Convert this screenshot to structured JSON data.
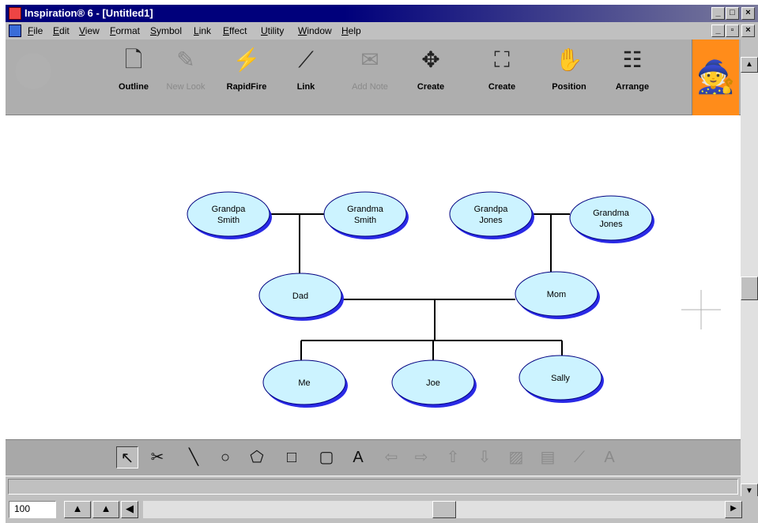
{
  "window": {
    "title": "Inspiration® 6 - [Untitled1]",
    "caption_buttons": [
      "_",
      "□",
      "×"
    ],
    "mdi_buttons": [
      "_",
      "▫",
      "×"
    ]
  },
  "menu": {
    "items": [
      "File",
      "Edit",
      "View",
      "Format",
      "Symbol",
      "Link",
      "Effect",
      "Utility",
      "Window",
      "Help"
    ]
  },
  "toolbar": {
    "tools": [
      {
        "label": "Outline",
        "icon": "outline-icon",
        "glyph": "🗋",
        "enabled": true
      },
      {
        "label": "New Look",
        "icon": "new-look-icon",
        "glyph": "✎",
        "enabled": false
      },
      {
        "label": "RapidFire",
        "icon": "rapidfire-icon",
        "glyph": "⚡",
        "enabled": true
      },
      {
        "label": "Link",
        "icon": "link-icon",
        "glyph": "⟋",
        "enabled": true
      },
      {
        "label": "Add Note",
        "icon": "add-note-icon",
        "glyph": "✉",
        "enabled": false
      },
      {
        "label": "Create",
        "icon": "create-arrows-icon",
        "glyph": "✥",
        "enabled": true
      },
      {
        "label": "Create",
        "icon": "create-expand-icon",
        "glyph": "⛶",
        "enabled": true
      },
      {
        "label": "Position",
        "icon": "hand-icon",
        "glyph": "✋",
        "enabled": true
      },
      {
        "label": "Arrange",
        "icon": "arrange-icon",
        "glyph": "☷",
        "enabled": true
      }
    ],
    "mascot_icon": "wizard-mascot-icon"
  },
  "diagram": {
    "colors": {
      "node_fill": "#ccf3ff",
      "node_shadow": "#2a2ae6",
      "node_stroke": "#000080",
      "link": "#000000"
    },
    "nodes": [
      {
        "id": "grandpa-smith",
        "lines": [
          "Grandpa",
          "Smith"
        ]
      },
      {
        "id": "grandma-smith",
        "lines": [
          "Grandma",
          "Smith"
        ]
      },
      {
        "id": "grandpa-jones",
        "lines": [
          "Grandpa",
          "Jones"
        ]
      },
      {
        "id": "grandma-jones",
        "lines": [
          "Grandma",
          "Jones"
        ]
      },
      {
        "id": "dad",
        "lines": [
          "Dad"
        ]
      },
      {
        "id": "mom",
        "lines": [
          "Mom"
        ]
      },
      {
        "id": "me",
        "lines": [
          "Me"
        ]
      },
      {
        "id": "joe",
        "lines": [
          "Joe"
        ]
      },
      {
        "id": "sally",
        "lines": [
          "Sally"
        ]
      }
    ]
  },
  "drawing_tools": [
    {
      "name": "pointer-tool",
      "glyph": "↖",
      "enabled": true,
      "active": true
    },
    {
      "name": "eraser-tool",
      "glyph": "✂",
      "enabled": true
    },
    {
      "name": "line-tool",
      "glyph": "╲",
      "enabled": true
    },
    {
      "name": "oval-tool",
      "glyph": "○",
      "enabled": true
    },
    {
      "name": "polygon-tool",
      "glyph": "⬠",
      "enabled": true
    },
    {
      "name": "rectangle-tool",
      "glyph": "□",
      "enabled": true
    },
    {
      "name": "rounded-rect-tool",
      "glyph": "▢",
      "enabled": true
    },
    {
      "name": "text-tool",
      "glyph": "A",
      "enabled": true
    },
    {
      "name": "arrow-left-tool",
      "glyph": "⇦",
      "enabled": false
    },
    {
      "name": "arrow-right-tool",
      "glyph": "⇨",
      "enabled": false
    },
    {
      "name": "arrow-up-tool",
      "glyph": "⇧",
      "enabled": false
    },
    {
      "name": "arrow-down-tool",
      "glyph": "⇩",
      "enabled": false
    },
    {
      "name": "fill-tool",
      "glyph": "▨",
      "enabled": false
    },
    {
      "name": "note-tool",
      "glyph": "▤",
      "enabled": false
    },
    {
      "name": "link-draw-tool",
      "glyph": "⟋",
      "enabled": false
    },
    {
      "name": "font-tool",
      "glyph": "A",
      "enabled": false
    }
  ],
  "statusbar": {
    "zoom": "100"
  }
}
